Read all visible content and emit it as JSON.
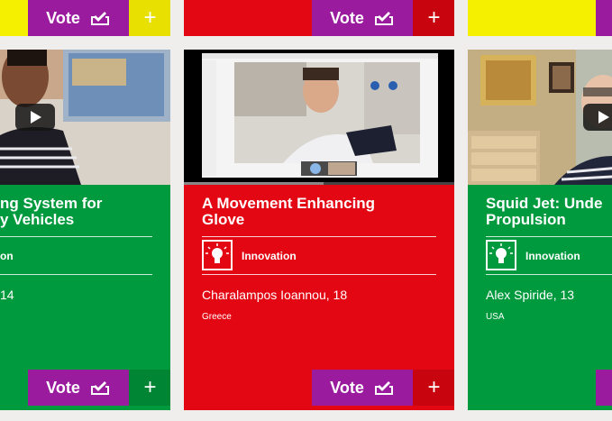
{
  "colors": {
    "yellow": "#f5f000",
    "red": "#e30613",
    "green": "#009a3e",
    "purple": "#9b1b9e",
    "background": "#efeeec"
  },
  "buttons": {
    "vote_label": "Vote",
    "add_label": "+"
  },
  "cards": [
    {
      "title": "ng System for\ny Vehicles",
      "category": "on",
      "name": "14",
      "country": "",
      "color": "#009a3e"
    },
    {
      "title": "A Movement Enhancing\nGlove",
      "category": "Innovation",
      "name": "Charalampos Ioannou, 18",
      "country": "Greece",
      "color": "#e30613"
    },
    {
      "title": "Squid Jet: Unde\nPropulsion",
      "category": "Innovation",
      "name": "Alex Spiride, 13",
      "country": "USA",
      "color": "#009a3e"
    }
  ]
}
